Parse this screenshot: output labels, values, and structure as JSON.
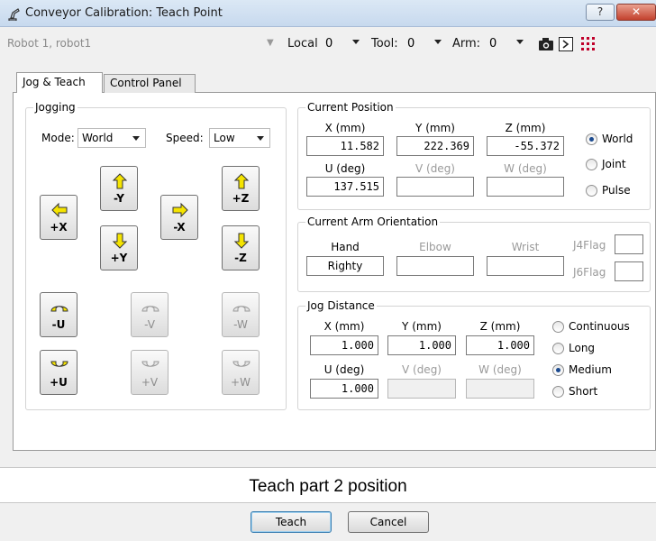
{
  "window": {
    "title": "Conveyor Calibration: Teach Point",
    "help_label": "?",
    "close_label": "✕"
  },
  "toolbar": {
    "robot": "Robot  1, robot1",
    "local_label": "Local",
    "local_value": "0",
    "tool_label": "Tool:",
    "tool_value": "0",
    "arm_label": "Arm:",
    "arm_value": "0"
  },
  "tabs": [
    {
      "label": "Jog & Teach"
    },
    {
      "label": "Control Panel"
    }
  ],
  "jogging": {
    "title": "Jogging",
    "mode_label": "Mode:",
    "mode_value": "World",
    "speed_label": "Speed:",
    "speed_value": "Low",
    "buttons": {
      "plus_x": "+X",
      "minus_y": "-Y",
      "plus_y": "+Y",
      "minus_x": "-X",
      "plus_z": "+Z",
      "minus_z": "-Z",
      "minus_u": "-U",
      "minus_v": "-V",
      "minus_w": "-W",
      "plus_u": "+U",
      "plus_v": "+V",
      "plus_w": "+W"
    }
  },
  "current_position": {
    "title": "Current Position",
    "x_head": "X (mm)",
    "y_head": "Y (mm)",
    "z_head": "Z (mm)",
    "u_head": "U (deg)",
    "v_head": "V (deg)",
    "w_head": "W (deg)",
    "x": "11.582",
    "y": "222.369",
    "z": "-55.372",
    "u": "137.515",
    "v": "",
    "w": "",
    "radios": {
      "world": "World",
      "joint": "Joint",
      "pulse": "Pulse"
    }
  },
  "arm_orientation": {
    "title": "Current Arm Orientation",
    "hand_head": "Hand",
    "elbow_head": "Elbow",
    "wrist_head": "Wrist",
    "hand": "Righty",
    "elbow": "",
    "wrist": "",
    "j4flag_label": "J4Flag",
    "j6flag_label": "J6Flag"
  },
  "jog_distance": {
    "title": "Jog Distance",
    "x_head": "X (mm)",
    "y_head": "Y (mm)",
    "z_head": "Z (mm)",
    "u_head": "U (deg)",
    "v_head": "V (deg)",
    "w_head": "W (deg)",
    "x": "1.000",
    "y": "1.000",
    "z": "1.000",
    "u": "1.000",
    "v": "",
    "w": "",
    "radios": {
      "continuous": "Continuous",
      "long": "Long",
      "medium": "Medium",
      "short": "Short"
    }
  },
  "prompt": "Teach part 2 position",
  "buttons": {
    "teach": "Teach",
    "cancel": "Cancel"
  },
  "colors": {
    "arrow_yellow": "#f5e400",
    "selected_radio": "#1b4a8f",
    "close_red": "#c3412d"
  }
}
